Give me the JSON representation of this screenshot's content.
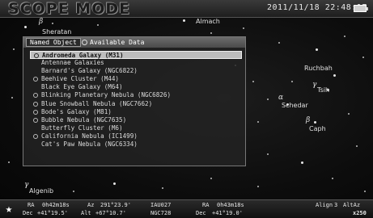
{
  "header": {
    "mode_title": "SCOPE MODE",
    "datetime": "2011/11/18 22:48:17"
  },
  "sky_labels": {
    "alamch": "Almach",
    "caph": "Caph",
    "schedar": "Schedar",
    "ruchbah": "Ruchbah",
    "tsih": "Tsih",
    "sheratan": "Sheratan",
    "algenib": "Algenib"
  },
  "panel": {
    "tab_named": "Named Object",
    "tab_available": "Available Data",
    "items": [
      {
        "label": "Andromeda Galaxy (M31)",
        "marked": true,
        "selected": true
      },
      {
        "label": "Antennae Galaxies",
        "marked": false
      },
      {
        "label": "Barnard's Galaxy (NGC6822)",
        "marked": false
      },
      {
        "label": "Beehive Cluster (M44)",
        "marked": true
      },
      {
        "label": "Black Eye Galaxy (M64)",
        "marked": false
      },
      {
        "label": "Blinking Planetary Nebula (NGC6826)",
        "marked": true
      },
      {
        "label": "Blue Snowball Nebula (NGC7662)",
        "marked": true
      },
      {
        "label": "Bode's Galaxy (M81)",
        "marked": true
      },
      {
        "label": "Bubble Nebula (NGC7635)",
        "marked": true
      },
      {
        "label": "Butterfly Cluster (M6)",
        "marked": false
      },
      {
        "label": "California Nebula (IC1499)",
        "marked": true
      },
      {
        "label": "Cat's Paw Nebula (NGC6334)",
        "marked": false
      }
    ]
  },
  "footer": {
    "ra_label": "RA",
    "ra_value": "0h42m18s",
    "dec_label": "Dec",
    "dec_value": "+41°19.5'",
    "az_label": "Az",
    "az_value": "291°23.9'",
    "alt_label": "Alt",
    "alt_value": "+67°10.7'",
    "field1_top": "IAU027",
    "field1_bottom": "NGC728",
    "ra2_label": "RA",
    "ra2_value": "0h43m18s",
    "dec2_label": "Dec",
    "dec2_value": "+41°19.0'",
    "align_label": "Align",
    "align_value": "3",
    "altaz_label": "AltAz",
    "zoom": "x250"
  }
}
